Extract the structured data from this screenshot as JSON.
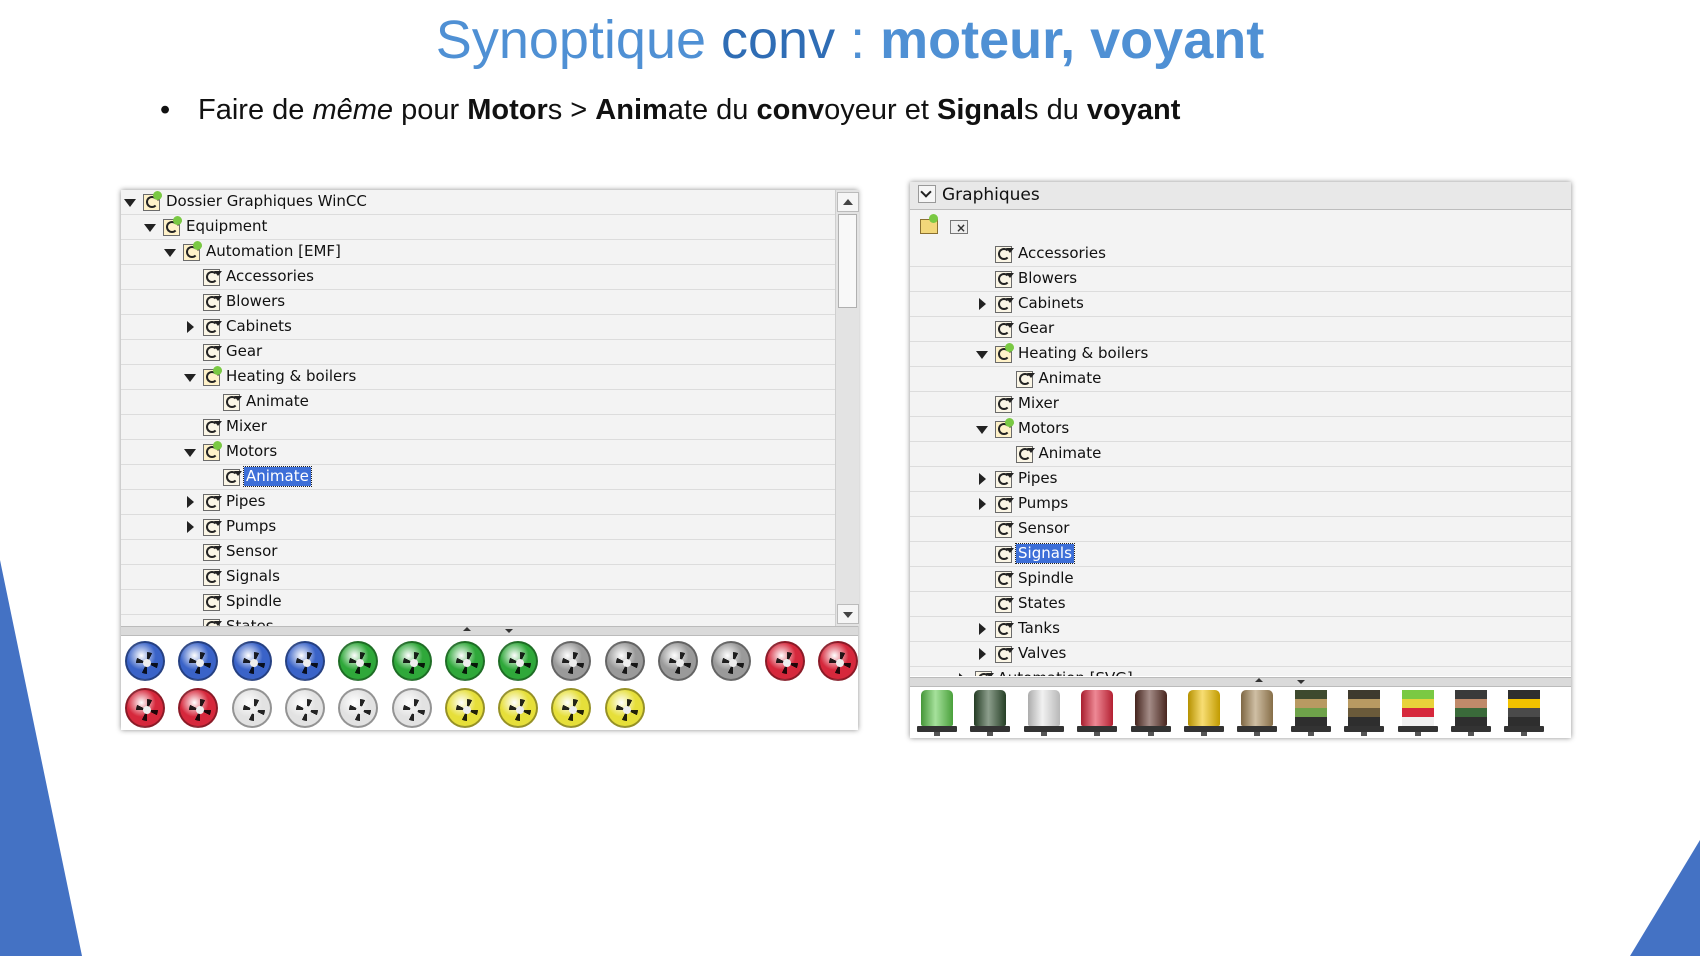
{
  "slide": {
    "title_part1": "Synoptique ",
    "title_part2": "conv",
    "title_part3": " : ",
    "title_part4": "moteur, voyant",
    "bullet": {
      "w1": "Faire de ",
      "w2": "même",
      "w3": " pour ",
      "w4": "Motor",
      "w5": "s > ",
      "w6": "Anim",
      "w7": "ate du ",
      "w8": "conv",
      "w9": "oyeur et ",
      "w10": "Signal",
      "w11": "s du ",
      "w12": "voyant"
    },
    "colors": {
      "title_light": "#4f90d4",
      "title_dark": "#2f6db5",
      "accent_triangle": "#4472c4",
      "selection": "#3d6fd8"
    }
  },
  "left_panel": {
    "tree": [
      {
        "label": "Dossier Graphiques WinCC",
        "state": "expanded",
        "icon": "folder-special-icon"
      },
      {
        "label": "Equipment",
        "state": "expanded",
        "icon": "folder-expanded-icon"
      },
      {
        "label": "Automation [EMF]",
        "state": "expanded",
        "icon": "folder-expanded-icon"
      },
      {
        "label": "Accessories",
        "state": "leaf",
        "icon": "graphic-folder-icon"
      },
      {
        "label": "Blowers",
        "state": "leaf",
        "icon": "graphic-folder-icon"
      },
      {
        "label": "Cabinets",
        "state": "collapsed",
        "icon": "graphic-folder-icon"
      },
      {
        "label": "Gear",
        "state": "leaf",
        "icon": "graphic-folder-icon"
      },
      {
        "label": "Heating & boilers",
        "state": "expanded",
        "icon": "folder-expanded-icon"
      },
      {
        "label": "Animate",
        "state": "leaf",
        "icon": "graphic-folder-icon"
      },
      {
        "label": "Mixer",
        "state": "leaf",
        "icon": "graphic-folder-icon"
      },
      {
        "label": "Motors",
        "state": "expanded",
        "icon": "folder-expanded-icon"
      },
      {
        "label": "Animate",
        "state": "leaf",
        "icon": "graphic-folder-icon",
        "selected": true
      },
      {
        "label": "Pipes",
        "state": "collapsed",
        "icon": "graphic-folder-icon"
      },
      {
        "label": "Pumps",
        "state": "collapsed",
        "icon": "graphic-folder-icon"
      },
      {
        "label": "Sensor",
        "state": "leaf",
        "icon": "graphic-folder-icon"
      },
      {
        "label": "Signals",
        "state": "leaf",
        "icon": "graphic-folder-icon"
      },
      {
        "label": "Spindle",
        "state": "leaf",
        "icon": "graphic-folder-icon"
      },
      {
        "label": "States",
        "state": "leaf",
        "icon": "graphic-folder-icon"
      }
    ],
    "gallery": [
      {
        "icon": "fan-blue-icon",
        "color": "#3a63c8"
      },
      {
        "icon": "fan-blue-icon",
        "color": "#3a63c8"
      },
      {
        "icon": "fan-blue-icon",
        "color": "#3a63c8"
      },
      {
        "icon": "fan-blue-icon",
        "color": "#3a63c8"
      },
      {
        "icon": "fan-green-icon",
        "color": "#2fa83a"
      },
      {
        "icon": "fan-green-icon",
        "color": "#2fa83a"
      },
      {
        "icon": "fan-green-icon",
        "color": "#2fa83a"
      },
      {
        "icon": "fan-green-icon",
        "color": "#2fa83a"
      },
      {
        "icon": "fan-grey-icon",
        "color": "#9a9a9a"
      },
      {
        "icon": "fan-grey-icon",
        "color": "#9a9a9a"
      },
      {
        "icon": "fan-grey-icon",
        "color": "#9a9a9a"
      },
      {
        "icon": "fan-grey-icon",
        "color": "#9a9a9a"
      },
      {
        "icon": "fan-red-icon",
        "color": "#d6283c"
      },
      {
        "icon": "fan-red-icon",
        "color": "#d6283c"
      },
      {
        "icon": "fan-red-icon",
        "color": "#d6283c"
      },
      {
        "icon": "fan-red-icon",
        "color": "#d6283c"
      },
      {
        "icon": "fan-white-icon",
        "color": "#e2e2e2"
      },
      {
        "icon": "fan-white-icon",
        "color": "#e2e2e2"
      },
      {
        "icon": "fan-white-icon",
        "color": "#e2e2e2"
      },
      {
        "icon": "fan-white-icon",
        "color": "#e2e2e2"
      },
      {
        "icon": "fan-yellow-icon",
        "color": "#e6df3a"
      },
      {
        "icon": "fan-yellow-icon",
        "color": "#e6df3a"
      },
      {
        "icon": "fan-yellow-icon",
        "color": "#e6df3a"
      },
      {
        "icon": "fan-yellow-icon",
        "color": "#e6df3a"
      }
    ]
  },
  "right_panel": {
    "header": "Graphiques",
    "toolbar": [
      {
        "icon": "new-folder-icon"
      },
      {
        "icon": "delete-folder-icon"
      }
    ],
    "tree": [
      {
        "label": "Accessories",
        "state": "leaf",
        "icon": "graphic-folder-icon"
      },
      {
        "label": "Blowers",
        "state": "leaf",
        "icon": "graphic-folder-icon"
      },
      {
        "label": "Cabinets",
        "state": "collapsed",
        "icon": "graphic-folder-icon"
      },
      {
        "label": "Gear",
        "state": "leaf",
        "icon": "graphic-folder-icon"
      },
      {
        "label": "Heating & boilers",
        "state": "expanded",
        "icon": "folder-expanded-icon"
      },
      {
        "label": "Animate",
        "state": "leaf",
        "icon": "graphic-folder-icon"
      },
      {
        "label": "Mixer",
        "state": "leaf",
        "icon": "graphic-folder-icon"
      },
      {
        "label": "Motors",
        "state": "expanded",
        "icon": "folder-expanded-icon"
      },
      {
        "label": "Animate",
        "state": "leaf",
        "icon": "graphic-folder-icon"
      },
      {
        "label": "Pipes",
        "state": "collapsed",
        "icon": "graphic-folder-icon"
      },
      {
        "label": "Pumps",
        "state": "collapsed",
        "icon": "graphic-folder-icon"
      },
      {
        "label": "Sensor",
        "state": "leaf",
        "icon": "graphic-folder-icon"
      },
      {
        "label": "Signals",
        "state": "leaf",
        "icon": "graphic-folder-icon",
        "selected": true
      },
      {
        "label": "Spindle",
        "state": "leaf",
        "icon": "graphic-folder-icon"
      },
      {
        "label": "States",
        "state": "leaf",
        "icon": "graphic-folder-icon"
      },
      {
        "label": "Tanks",
        "state": "collapsed",
        "icon": "graphic-folder-icon"
      },
      {
        "label": "Valves",
        "state": "collapsed",
        "icon": "graphic-folder-icon"
      },
      {
        "label": "Automation [SVG]",
        "state": "collapsed",
        "icon": "graphic-folder-icon"
      }
    ],
    "gallery": [
      {
        "icon": "signal-light-green-icon",
        "colors": [
          "#5cc84a"
        ]
      },
      {
        "icon": "signal-light-darkgreen-icon",
        "colors": [
          "#2f4f2f"
        ]
      },
      {
        "icon": "signal-light-white-icon",
        "colors": [
          "#e6e6e6"
        ]
      },
      {
        "icon": "signal-light-red-icon",
        "colors": [
          "#e0283e"
        ]
      },
      {
        "icon": "signal-light-brown-icon",
        "colors": [
          "#5a2f26"
        ]
      },
      {
        "icon": "signal-light-yellow-icon",
        "colors": [
          "#f2c200"
        ]
      },
      {
        "icon": "signal-light-tan-icon",
        "colors": [
          "#a88a5a"
        ]
      },
      {
        "icon": "signal-tower-icon",
        "colors": [
          "#3e4a2e",
          "#b89a62",
          "#6ea24a",
          "#2e2e2e"
        ]
      },
      {
        "icon": "signal-tower-icon",
        "colors": [
          "#3e3a2e",
          "#b89a62",
          "#6a5a3a",
          "#2e2e2e"
        ]
      },
      {
        "icon": "signal-tower-icon",
        "colors": [
          "#7ac943",
          "#e8d33a",
          "#d6283c",
          "#f0f0f0"
        ]
      },
      {
        "icon": "signal-tower-icon",
        "colors": [
          "#3a3a3a",
          "#c08a6a",
          "#3a6a3a",
          "#2e2e2e"
        ]
      },
      {
        "icon": "signal-tower-icon",
        "colors": [
          "#2e2e2e",
          "#f2c200",
          "#4a4a4a",
          "#2e2e2e"
        ]
      }
    ]
  }
}
